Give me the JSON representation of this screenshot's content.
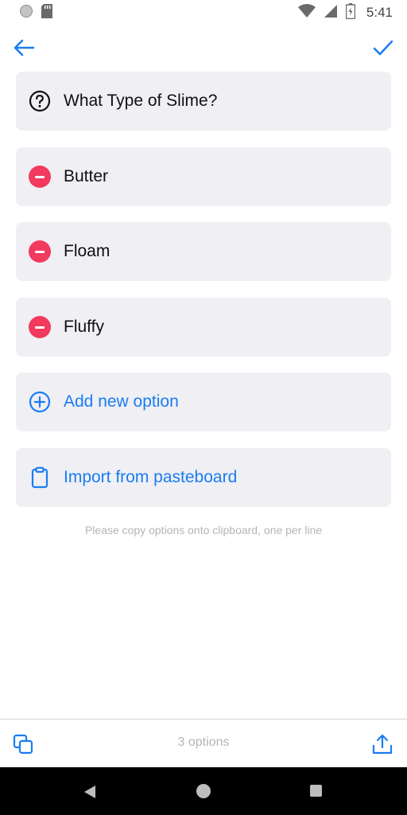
{
  "status_bar": {
    "time": "5:41"
  },
  "question": {
    "text": "What Type of Slime?"
  },
  "options": [
    {
      "label": "Butter"
    },
    {
      "label": "Floam"
    },
    {
      "label": "Fluffy"
    }
  ],
  "actions": {
    "add_label": "Add new option",
    "import_label": "Import from pasteboard"
  },
  "hint": "Please copy options onto clipboard, one per line",
  "bottom_bar": {
    "count": "3 options"
  },
  "colors": {
    "accent": "#1a7cf2",
    "remove": "#f2395e",
    "card_bg": "#efeff4"
  }
}
